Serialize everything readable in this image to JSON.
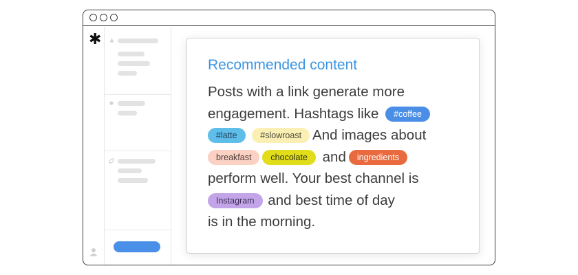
{
  "card": {
    "title": "Recommended content",
    "text": {
      "l1": "Posts with a link generate more",
      "l2": "engagement. Hashtags like",
      "l3": "And images about",
      "l4": "and",
      "l5": "perform well. Your best channel is",
      "l6": "and best time of day",
      "l7": "is in the morning."
    },
    "tags": {
      "coffee": "#coffee",
      "latte": "#latte",
      "slowroast": "#slowroast",
      "breakfast": "breakfast",
      "chocolate": "chocolate",
      "ingredients": "ingredients",
      "instagram": "Instagram"
    }
  },
  "sidebar": {
    "logo": "✱"
  },
  "colors": {
    "title_blue": "#3b95e3",
    "primary_button": "#4a90e8",
    "tag_coffee": "#4b8ee6",
    "tag_latte": "#5fbdea",
    "tag_slowroast": "#fbefb4",
    "tag_breakfast": "#fbd1c4",
    "tag_chocolate": "#e1dd1a",
    "tag_ingredients": "#e86a3e",
    "tag_instagram": "#c3a4e8"
  },
  "icons": {
    "rail_logo": "asterisk-icon",
    "rail_bottom": "user-icon",
    "section_1": "triangle-icon",
    "section_2": "dot-icon",
    "section_3": "leaf-icon"
  }
}
